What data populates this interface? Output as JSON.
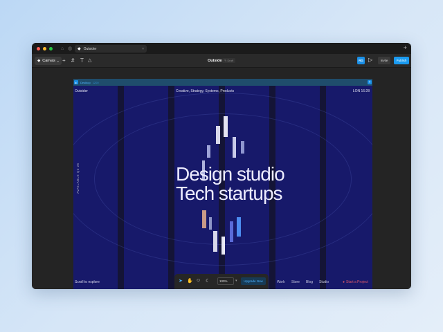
{
  "browser": {
    "tab_title": "Outsider",
    "tab_close": "×",
    "new_tab": "+"
  },
  "toolbar": {
    "canvas_label": "Canvas",
    "project_title": "Outsider",
    "project_badge": "Draft",
    "avatar_initials": "RG",
    "invite_label": "Invite",
    "publish_label": "Publish"
  },
  "frame": {
    "name": "Desktop",
    "size": "1200"
  },
  "site": {
    "name": "Outsider",
    "tagline": "Creative, Strategy, Systems, Products",
    "location_time": "LON  16:28",
    "availability": "AVAILABLE Q3 25",
    "hero_line1": "Design studio",
    "hero_line2": "Tech startups",
    "scroll_hint": "Scroll to explore",
    "nav": [
      "Work",
      "Store",
      "Blog",
      "Studio"
    ],
    "cta": "Start a Project"
  },
  "dock": {
    "zoom": "100%",
    "upgrade_label": "Upgrade Now"
  },
  "colors": {
    "accent": "#1a9af0",
    "frame_bg": "#17196a",
    "cta": "#e05a6a"
  }
}
